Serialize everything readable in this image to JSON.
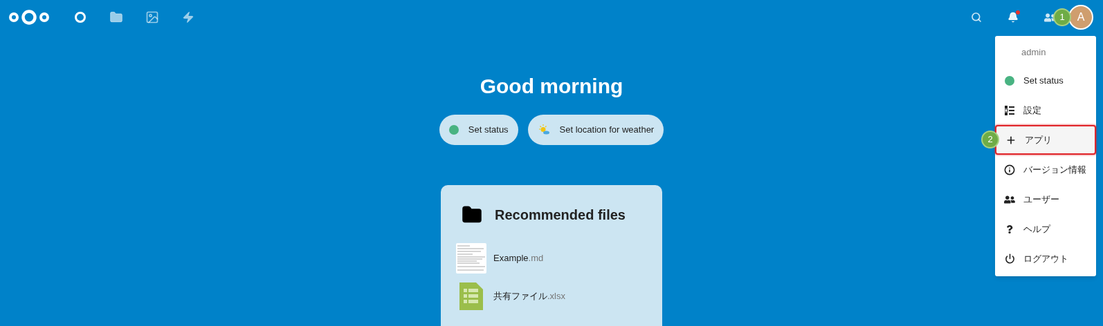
{
  "header": {
    "apps": [
      {
        "kind": "dashboard",
        "selected": true
      },
      {
        "kind": "files",
        "selected": false
      },
      {
        "kind": "photos",
        "selected": false
      },
      {
        "kind": "activity",
        "selected": false
      }
    ],
    "actions": [
      {
        "kind": "search"
      },
      {
        "kind": "notifications",
        "unread": true
      },
      {
        "kind": "contacts"
      }
    ],
    "avatar": {
      "initial": "A",
      "step": "1"
    }
  },
  "greeting": "Good morning",
  "chips": [
    {
      "kind": "status",
      "label": "Set status"
    },
    {
      "kind": "weather",
      "label": "Set location for weather"
    }
  ],
  "card": {
    "title": "Recommended files",
    "files": [
      {
        "kind": "document",
        "name": "Example",
        "ext": ".md"
      },
      {
        "kind": "spreadsheet",
        "name": "共有ファイル",
        "ext": ".xlsx"
      }
    ]
  },
  "menu": {
    "user": "admin",
    "items": [
      {
        "kind": "status",
        "label": "Set status",
        "highlighted": false
      },
      {
        "kind": "settings",
        "label": "設定",
        "highlighted": false
      },
      {
        "kind": "apps",
        "label": "アプリ",
        "highlighted": true,
        "step": "2"
      },
      {
        "kind": "about",
        "label": "バージョン情報",
        "highlighted": false
      },
      {
        "kind": "users",
        "label": "ユーザー",
        "highlighted": false
      },
      {
        "kind": "help",
        "label": "ヘルプ",
        "highlighted": false
      },
      {
        "kind": "logout",
        "label": "ログアウト",
        "highlighted": false
      }
    ]
  }
}
